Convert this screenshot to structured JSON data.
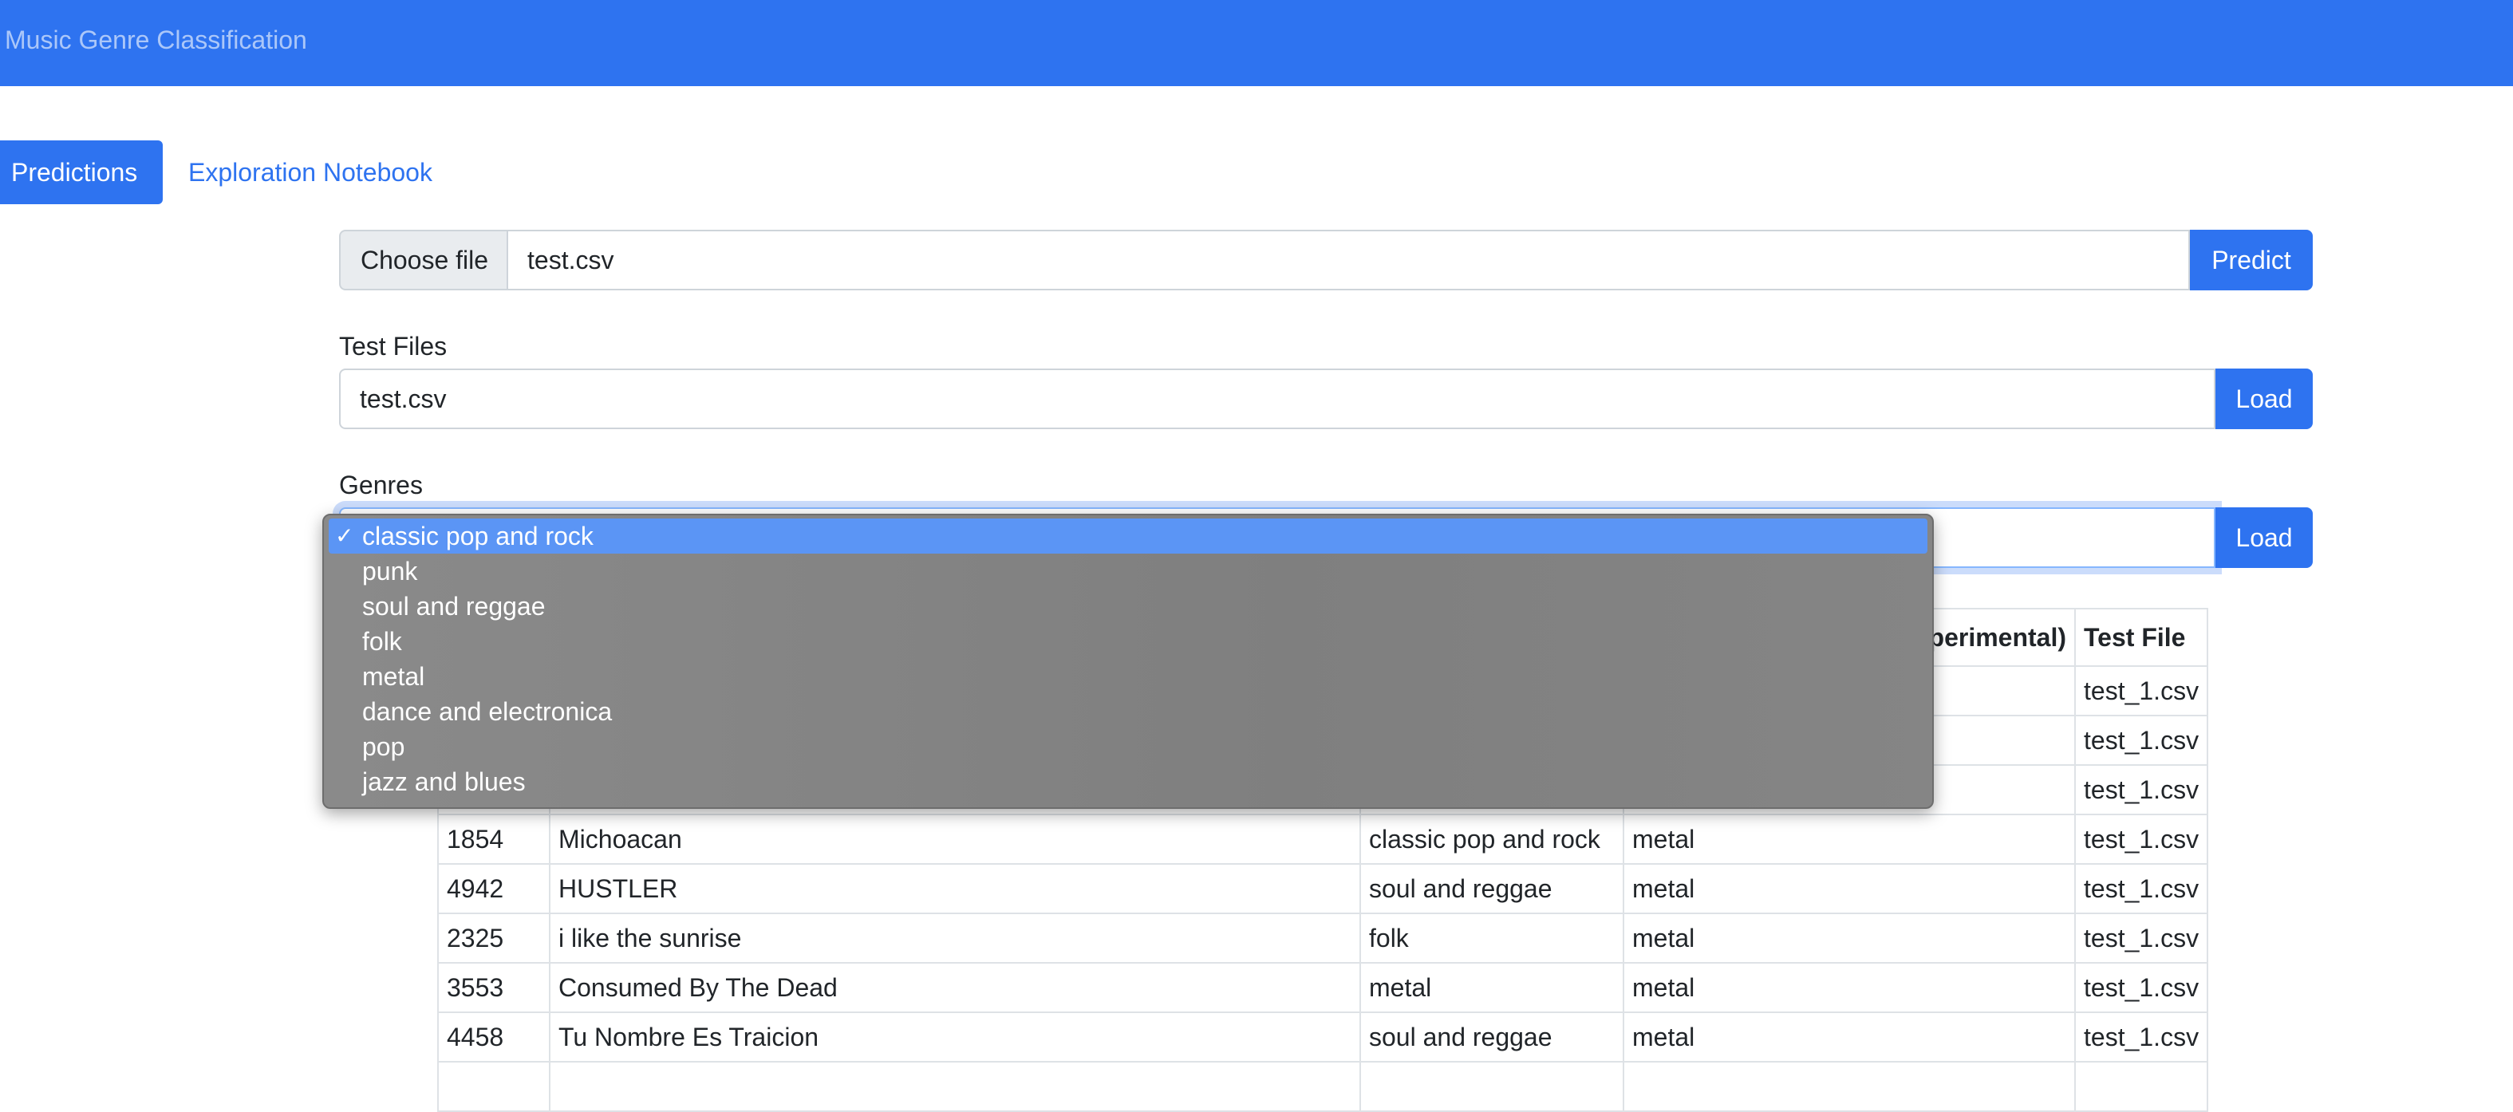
{
  "app": {
    "brand": "Music Genre Classification"
  },
  "tabs": [
    {
      "label": "Predictions",
      "active": true
    },
    {
      "label": "Exploration Notebook",
      "active": false
    }
  ],
  "upload": {
    "choose_label": "Choose file",
    "file_name": "test.csv",
    "predict_label": "Predict"
  },
  "test_files": {
    "label": "Test Files",
    "value": "test.csv",
    "load_label": "Load"
  },
  "genres": {
    "label": "Genres",
    "load_label": "Load",
    "check_glyph": "✓",
    "options": [
      "classic pop and rock",
      "punk",
      "soul and reggae",
      "folk",
      "metal",
      "dance and electronica",
      "pop",
      "jazz and blues"
    ],
    "selected_index": 0
  },
  "table": {
    "headers": [
      "",
      "",
      "",
      "perimental)",
      "Test File"
    ],
    "rows": [
      [
        "",
        "",
        "",
        "",
        "test_1.csv"
      ],
      [
        "",
        "",
        "",
        "",
        "test_1.csv"
      ],
      [
        "",
        "",
        "",
        "",
        "test_1.csv"
      ],
      [
        "1854",
        "Michoacan",
        "classic pop and rock",
        "metal",
        "test_1.csv"
      ],
      [
        "4942",
        "HUSTLER",
        "soul and reggae",
        "metal",
        "test_1.csv"
      ],
      [
        "2325",
        "i like the sunrise",
        "folk",
        "metal",
        "test_1.csv"
      ],
      [
        "3553",
        "Consumed By The Dead",
        "metal",
        "metal",
        "test_1.csv"
      ],
      [
        "4458",
        "Tu Nombre Es Traicion",
        "soul and reggae",
        "metal",
        "test_1.csv"
      ],
      [
        "",
        "",
        "",
        "",
        ""
      ]
    ]
  },
  "colors": {
    "primary": "#2e73f0",
    "selected_option": "#5b95f5"
  }
}
